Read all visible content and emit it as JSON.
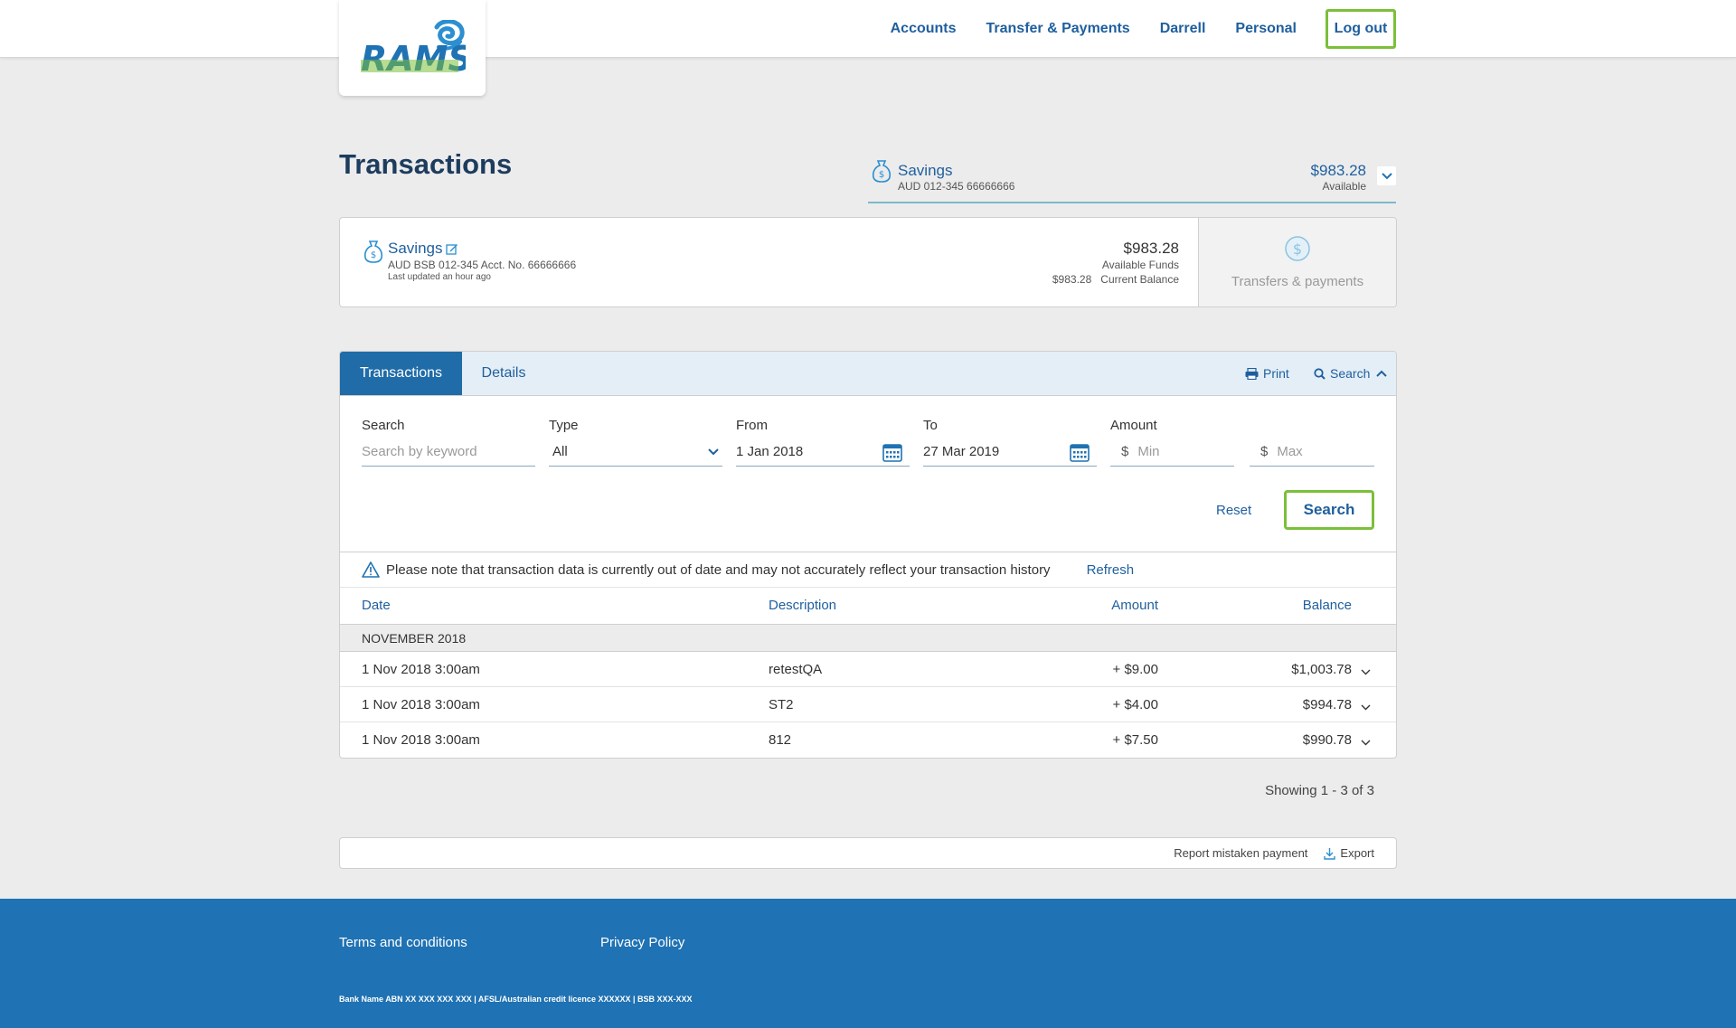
{
  "brand": {
    "logo_text": "RAMS",
    "primary": "#1f5f9e",
    "accent_green": "#7bbf3a",
    "footer_bg": "#1f72b3",
    "tab_active_bg": "#1f6ca8"
  },
  "nav": {
    "items": [
      "Accounts",
      "Transfer & Payments",
      "Darrell",
      "Personal"
    ],
    "logout": "Log out"
  },
  "page": {
    "title": "Transactions"
  },
  "account_selector": {
    "name": "Savings",
    "number": "AUD  012-345  66666666",
    "balance": "$983.28",
    "balance_label": "Available",
    "icon": "money-bag-icon"
  },
  "account_card": {
    "name": "Savings",
    "bsb_line": "AUD  BSB  012-345  Acct. No.  66666666",
    "updated": "Last updated an hour ago",
    "available_funds": "$983.28",
    "available_label": "Available Funds",
    "current_balance": "$983.28",
    "current_label": "Current Balance",
    "transfers_label": "Transfers & payments"
  },
  "tabs": {
    "transactions": "Transactions",
    "details": "Details"
  },
  "tools": {
    "print": "Print",
    "search": "Search"
  },
  "filters": {
    "search_label": "Search",
    "search_placeholder": "Search by keyword",
    "type_label": "Type",
    "type_value": "All",
    "from_label": "From",
    "from_value": "1 Jan 2018",
    "to_label": "To",
    "to_value": "27 Mar 2019",
    "amount_label": "Amount",
    "currency_symbol": "$",
    "min_placeholder": "Min",
    "max_placeholder": "Max",
    "reset": "Reset",
    "search_button": "Search"
  },
  "notice": {
    "text": "Please note that transaction data is currently out of date and may not accurately reflect your transaction history",
    "refresh": "Refresh"
  },
  "table": {
    "headers": {
      "date": "Date",
      "description": "Description",
      "amount": "Amount",
      "balance": "Balance"
    },
    "month": "NOVEMBER 2018",
    "rows": [
      {
        "date": "1 Nov 2018 3:00am",
        "description": "retestQA",
        "amount": "+ $9.00",
        "balance": "$1,003.78"
      },
      {
        "date": "1 Nov 2018 3:00am",
        "description": "ST2",
        "amount": "+ $4.00",
        "balance": "$994.78"
      },
      {
        "date": "1 Nov 2018 3:00am",
        "description": "812",
        "amount": "+ $7.50",
        "balance": "$990.78"
      }
    ]
  },
  "pagination": {
    "showing": "Showing 1 - 3 of 3"
  },
  "actions": {
    "report": "Report mistaken payment",
    "export": "Export"
  },
  "footer": {
    "terms": "Terms and conditions",
    "privacy": "Privacy Policy",
    "legal": "Bank Name ABN XX XXX XXX XXX | AFSL/Australian credit licence XXXXXX | BSB XXX-XXX"
  }
}
